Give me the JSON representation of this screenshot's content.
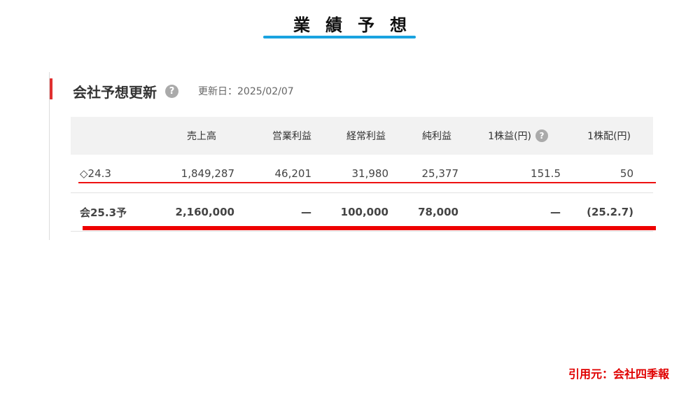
{
  "slide": {
    "title": "業績予想",
    "source": "引用元：会社四季報"
  },
  "section": {
    "title": "会社予想更新",
    "help_icon": "question-circle-icon",
    "update_date": "更新日：2025/02/07"
  },
  "table": {
    "headers": [
      "",
      "売上高",
      "営業利益",
      "経常利益",
      "純利益",
      "1株益(円)",
      "1株配(円)"
    ],
    "rows": [
      [
        "◇24.3",
        "1,849,287",
        "46,201",
        "31,980",
        "25,377",
        "151.5",
        "50"
      ],
      [
        "会25.3予",
        "2,160,000",
        "—",
        "100,000",
        "78,000",
        "—",
        "(25.2.7)"
      ]
    ]
  },
  "colors": {
    "accent": "#e03030",
    "title_underline": "#19a3e0",
    "highlight": "#ee0000"
  }
}
